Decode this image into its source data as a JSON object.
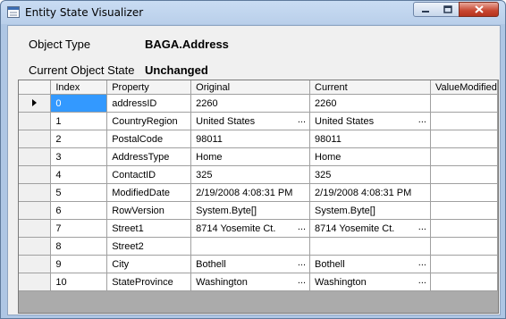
{
  "window": {
    "title": "Entity State Visualizer"
  },
  "info": {
    "object_type_label": "Object Type",
    "object_type_value": "BAGA.Address",
    "state_label": "Current Object State",
    "state_value": "Unchanged"
  },
  "grid": {
    "columns": [
      "Index",
      "Property",
      "Original",
      "Current",
      "ValueModified"
    ],
    "rows": [
      {
        "index": "0",
        "property": "addressID",
        "original": "2260",
        "current": "2260",
        "modified": "",
        "orig_ellipsis": "",
        "cur_ellipsis": ""
      },
      {
        "index": "1",
        "property": "CountryRegion",
        "original": "United States",
        "current": "United States",
        "modified": "",
        "orig_ellipsis": "...",
        "cur_ellipsis": "..."
      },
      {
        "index": "2",
        "property": "PostalCode",
        "original": "98011",
        "current": "98011",
        "modified": "",
        "orig_ellipsis": "",
        "cur_ellipsis": ""
      },
      {
        "index": "3",
        "property": "AddressType",
        "original": "Home",
        "current": "Home",
        "modified": "",
        "orig_ellipsis": "",
        "cur_ellipsis": ""
      },
      {
        "index": "4",
        "property": "ContactID",
        "original": "325",
        "current": "325",
        "modified": "",
        "orig_ellipsis": "",
        "cur_ellipsis": ""
      },
      {
        "index": "5",
        "property": "ModifiedDate",
        "original": "2/19/2008 4:08:31 PM",
        "current": "2/19/2008 4:08:31 PM",
        "modified": "",
        "orig_ellipsis": "",
        "cur_ellipsis": ""
      },
      {
        "index": "6",
        "property": "RowVersion",
        "original": "System.Byte[]",
        "current": "System.Byte[]",
        "modified": "",
        "orig_ellipsis": "",
        "cur_ellipsis": ""
      },
      {
        "index": "7",
        "property": "Street1",
        "original": "8714 Yosemite Ct.",
        "current": "8714 Yosemite Ct.",
        "modified": "",
        "orig_ellipsis": "...",
        "cur_ellipsis": "..."
      },
      {
        "index": "8",
        "property": "Street2",
        "original": "",
        "current": "",
        "modified": "",
        "orig_ellipsis": "",
        "cur_ellipsis": ""
      },
      {
        "index": "9",
        "property": "City",
        "original": "Bothell",
        "current": "Bothell",
        "modified": "",
        "orig_ellipsis": "...",
        "cur_ellipsis": "..."
      },
      {
        "index": "10",
        "property": "StateProvince",
        "original": "Washington",
        "current": "Washington",
        "modified": "",
        "orig_ellipsis": "...",
        "cur_ellipsis": "..."
      }
    ]
  },
  "colors": {
    "selection": "#3399ff",
    "close_button": "#c7452f"
  }
}
